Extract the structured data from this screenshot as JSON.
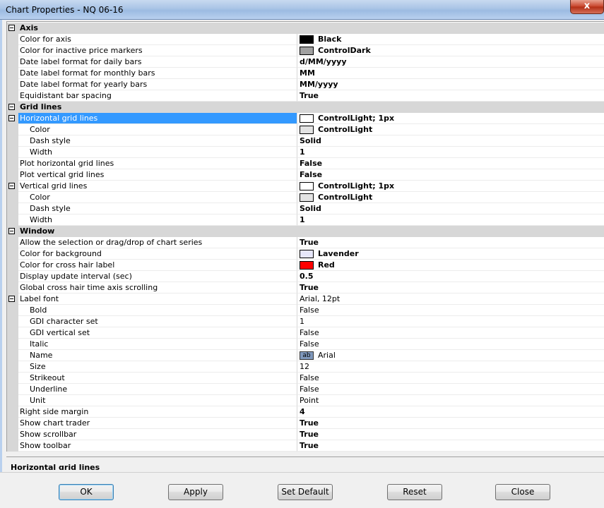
{
  "window": {
    "title": "Chart Properties - NQ 06-16",
    "close_glyph": "x"
  },
  "grid": {
    "rows": [
      {
        "kind": "cat",
        "name": "Axis"
      },
      {
        "kind": "prop",
        "indent": 0,
        "name": "Color for axis",
        "value": "Black",
        "bold": true,
        "swatch": "#000000"
      },
      {
        "kind": "prop",
        "indent": 0,
        "name": "Color for inactive price markers",
        "value": "ControlDark",
        "bold": true,
        "swatch": "#a0a0a0"
      },
      {
        "kind": "prop",
        "indent": 0,
        "name": "Date label format for daily bars",
        "value": "d/MM/yyyy",
        "bold": true
      },
      {
        "kind": "prop",
        "indent": 0,
        "name": "Date label format for monthly bars",
        "value": "MM",
        "bold": true
      },
      {
        "kind": "prop",
        "indent": 0,
        "name": "Date label format for yearly bars",
        "value": "MM/yyyy",
        "bold": true
      },
      {
        "kind": "prop",
        "indent": 0,
        "name": "Equidistant bar spacing",
        "value": "True",
        "bold": true
      },
      {
        "kind": "cat",
        "name": "Grid lines"
      },
      {
        "kind": "prop",
        "indent": 0,
        "expander": true,
        "selected": true,
        "name": "Horizontal grid lines",
        "value": "ControlLight; 1px",
        "bold": true,
        "swatch": "#ffffff"
      },
      {
        "kind": "prop",
        "indent": 1,
        "name": "Color",
        "value": "ControlLight",
        "bold": true,
        "swatch": "#e3e3e3"
      },
      {
        "kind": "prop",
        "indent": 1,
        "name": "Dash style",
        "value": "Solid",
        "bold": true
      },
      {
        "kind": "prop",
        "indent": 1,
        "name": "Width",
        "value": "1",
        "bold": true
      },
      {
        "kind": "prop",
        "indent": 0,
        "name": "Plot horizontal grid lines",
        "value": "False",
        "bold": true
      },
      {
        "kind": "prop",
        "indent": 0,
        "name": "Plot vertical grid lines",
        "value": "False",
        "bold": true
      },
      {
        "kind": "prop",
        "indent": 0,
        "expander": true,
        "name": "Vertical grid lines",
        "value": "ControlLight; 1px",
        "bold": true,
        "swatch": "#ffffff"
      },
      {
        "kind": "prop",
        "indent": 1,
        "name": "Color",
        "value": "ControlLight",
        "bold": true,
        "swatch": "#e3e3e3"
      },
      {
        "kind": "prop",
        "indent": 1,
        "name": "Dash style",
        "value": "Solid",
        "bold": true
      },
      {
        "kind": "prop",
        "indent": 1,
        "name": "Width",
        "value": "1",
        "bold": true
      },
      {
        "kind": "cat",
        "name": "Window"
      },
      {
        "kind": "prop",
        "indent": 0,
        "name": "Allow the selection or drag/drop of chart series",
        "value": "True",
        "bold": true
      },
      {
        "kind": "prop",
        "indent": 0,
        "name": "Color for background",
        "value": "Lavender",
        "bold": true,
        "swatch": "#e6e6fa"
      },
      {
        "kind": "prop",
        "indent": 0,
        "name": "Color for cross hair label",
        "value": "Red",
        "bold": true,
        "swatch": "#ff0000"
      },
      {
        "kind": "prop",
        "indent": 0,
        "name": "Display update interval (sec)",
        "value": "0.5",
        "bold": true
      },
      {
        "kind": "prop",
        "indent": 0,
        "name": "Global cross hair time axis scrolling",
        "value": "True",
        "bold": true
      },
      {
        "kind": "prop",
        "indent": 0,
        "expander": true,
        "name": "Label font",
        "value": "Arial, 12pt",
        "bold": false
      },
      {
        "kind": "prop",
        "indent": 1,
        "name": "Bold",
        "value": "False",
        "bold": false
      },
      {
        "kind": "prop",
        "indent": 1,
        "name": "GDI character set",
        "value": "1",
        "bold": false
      },
      {
        "kind": "prop",
        "indent": 1,
        "name": "GDI vertical set",
        "value": "False",
        "bold": false
      },
      {
        "kind": "prop",
        "indent": 1,
        "name": "Italic",
        "value": "False",
        "bold": false
      },
      {
        "kind": "prop",
        "indent": 1,
        "name": "Name",
        "value": "Arial",
        "bold": false,
        "fontpreview": "ab"
      },
      {
        "kind": "prop",
        "indent": 1,
        "name": "Size",
        "value": "12",
        "bold": false
      },
      {
        "kind": "prop",
        "indent": 1,
        "name": "Strikeout",
        "value": "False",
        "bold": false
      },
      {
        "kind": "prop",
        "indent": 1,
        "name": "Underline",
        "value": "False",
        "bold": false
      },
      {
        "kind": "prop",
        "indent": 1,
        "name": "Unit",
        "value": "Point",
        "bold": false
      },
      {
        "kind": "prop",
        "indent": 0,
        "name": "Right side margin",
        "value": "4",
        "bold": true
      },
      {
        "kind": "prop",
        "indent": 0,
        "name": "Show chart trader",
        "value": "True",
        "bold": true
      },
      {
        "kind": "prop",
        "indent": 0,
        "name": "Show scrollbar",
        "value": "True",
        "bold": true
      },
      {
        "kind": "prop",
        "indent": 0,
        "name": "Show toolbar",
        "value": "True",
        "bold": true
      }
    ]
  },
  "description": {
    "title": "Horizontal grid lines"
  },
  "buttons": {
    "ok": "OK",
    "apply": "Apply",
    "set_default": "Set Default",
    "reset": "Reset",
    "close": "Close"
  },
  "colors": {
    "selection": "#3399ff",
    "category_bg": "#d7d7d7"
  }
}
